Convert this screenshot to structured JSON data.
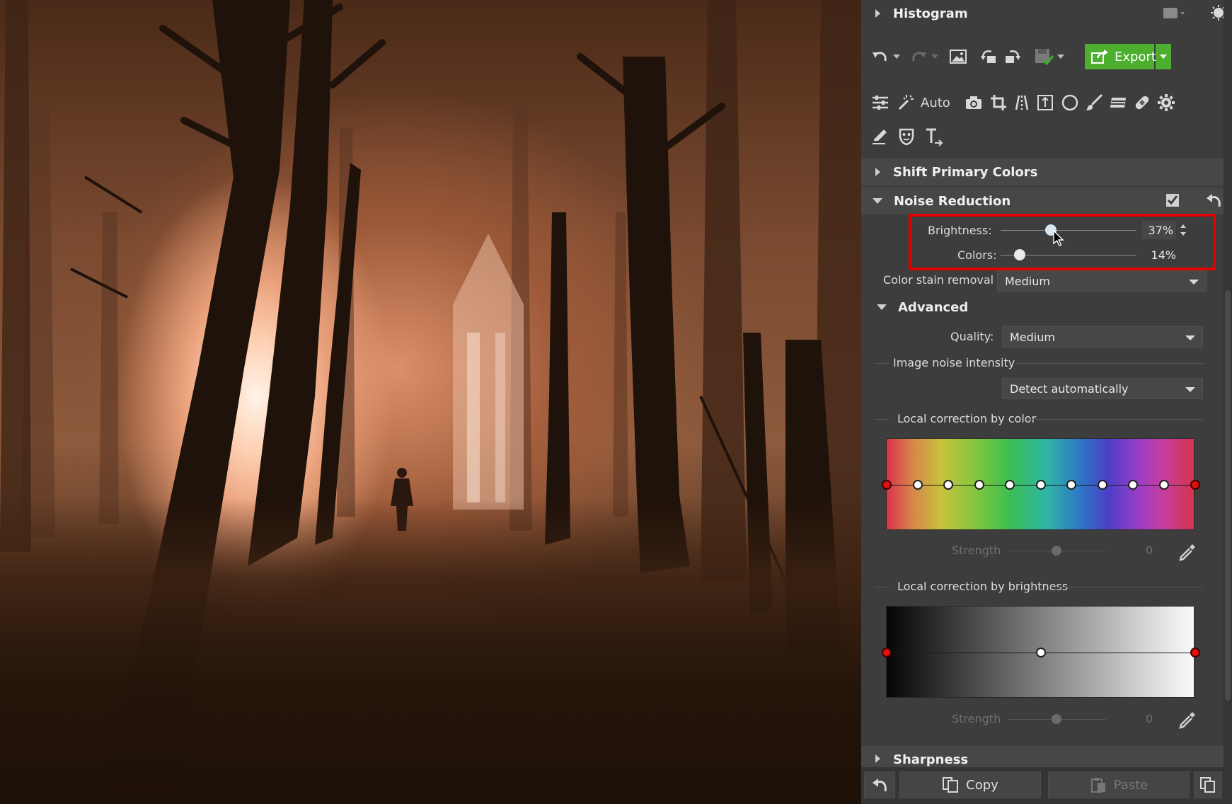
{
  "panel": {
    "histogram": {
      "title": "Histogram"
    },
    "toolbar": {
      "export_label": "Export",
      "auto_label": "Auto"
    },
    "sections": {
      "shift_primary": {
        "title": "Shift Primary Colors"
      },
      "noise_reduction": {
        "title": "Noise Reduction",
        "brightness": {
          "label": "Brightness:",
          "value": "37%",
          "level": 0.37
        },
        "colors": {
          "label": "Colors:",
          "value": "14%",
          "level": 0.14
        },
        "color_stain": {
          "label": "Color stain removal",
          "value": "Medium"
        },
        "advanced": {
          "title": "Advanced",
          "quality": {
            "label": "Quality:",
            "value": "Medium"
          },
          "image_noise": {
            "label": "Image noise intensity",
            "value": "Detect automatically"
          },
          "local_color": {
            "label": "Local correction by color",
            "strength_label": "Strength",
            "strength_value": "0"
          },
          "local_brightness": {
            "label": "Local correction by brightness",
            "strength_label": "Strength",
            "strength_value": "0"
          }
        }
      },
      "sharpness": {
        "title": "Sharpness"
      }
    },
    "bottom": {
      "copy_label": "Copy",
      "paste_label": "Paste"
    }
  },
  "colors": {
    "export_green": "#4caf2e",
    "highlight_red": "#e00000",
    "panel_bg": "#3d3d3d"
  }
}
